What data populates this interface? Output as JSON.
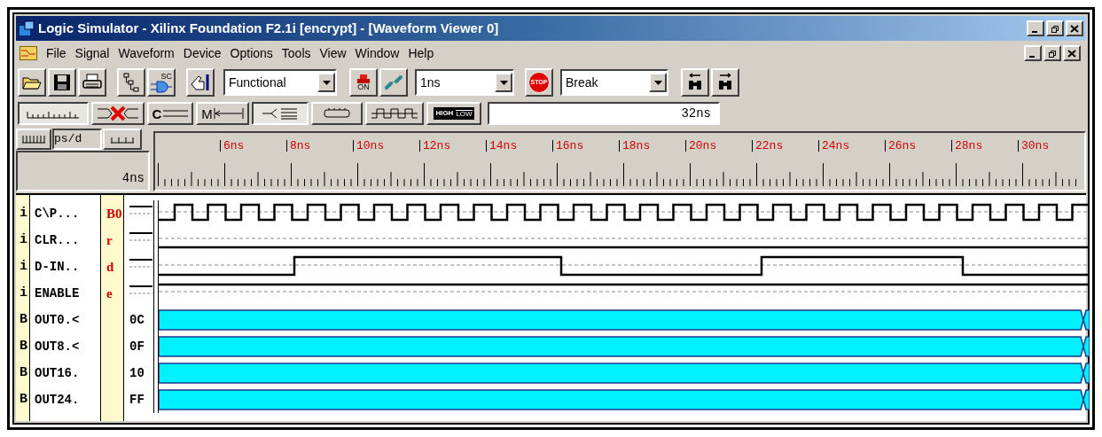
{
  "window": {
    "title": "Logic Simulator - Xilinx Foundation F2.1i [encrypt] - [Waveform Viewer 0]"
  },
  "menu": [
    "File",
    "Signal",
    "Waveform",
    "Device",
    "Options",
    "Tools",
    "View",
    "Window",
    "Help"
  ],
  "toolbar": {
    "sc_label": "SC",
    "on_label": "ON",
    "mode": "Functional",
    "step": "1ns",
    "stop_label": "STOP",
    "break": "Break"
  },
  "toolbar2": {
    "buttons": [
      {
        "selected": true
      },
      {
        "selected": false
      },
      {
        "label": "C",
        "selected": false
      },
      {
        "label": "M",
        "selected": false
      },
      {
        "selected": true
      },
      {
        "selected": false
      },
      {
        "selected": false
      },
      {
        "label": "HIGH LOW",
        "selected": false
      }
    ],
    "time": "32ns"
  },
  "ruler": {
    "scale_field": "ps/d",
    "cursor_time": "4ns",
    "ticks": [
      "6ns",
      "8ns",
      "10ns",
      "12ns",
      "14ns",
      "16ns",
      "18ns",
      "20ns",
      "22ns",
      "24ns",
      "26ns",
      "28ns",
      "30ns"
    ]
  },
  "signals": [
    {
      "type": "i",
      "name": "C\\P...",
      "key": "B0",
      "kind": "clock"
    },
    {
      "type": "i",
      "name": "CLR...",
      "key": "r",
      "kind": "low"
    },
    {
      "type": "i",
      "name": "D-IN..",
      "key": "d",
      "kind": "pulse"
    },
    {
      "type": "i",
      "name": "ENABLE",
      "key": "e",
      "kind": "high"
    },
    {
      "type": "B",
      "name": "OUT0.<",
      "value": "0C",
      "kind": "bus"
    },
    {
      "type": "B",
      "name": "OUT8.<",
      "value": "0F",
      "kind": "bus"
    },
    {
      "type": "B",
      "name": "OUT16.",
      "value": "10",
      "kind": "bus"
    },
    {
      "type": "B",
      "name": "OUT24.",
      "value": "FF",
      "kind": "bus"
    }
  ]
}
